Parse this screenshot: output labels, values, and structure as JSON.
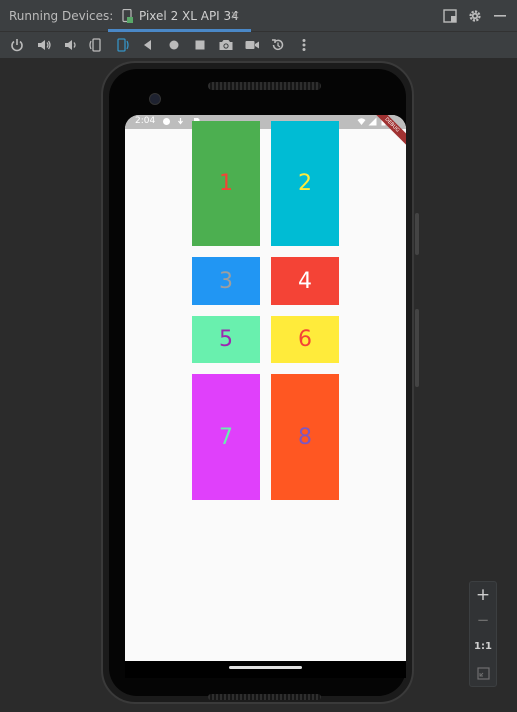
{
  "tabbar": {
    "title": "Running Devices:",
    "tab_label": "Pixel 2 XL API 34",
    "tab_close": "×",
    "right_icons": [
      "layout-icon",
      "gear-icon",
      "minimize-icon"
    ]
  },
  "toolbar": {
    "icons": [
      "power-icon",
      "volume-up-icon",
      "volume-down-icon",
      "rotate-left-icon",
      "rotate-right-icon",
      "back-icon",
      "home-icon",
      "overview-icon",
      "screenshot-icon",
      "screen-record-icon",
      "snapshot-icon",
      "more-icon"
    ]
  },
  "device": {
    "status_time": "2:04",
    "debug_banner": "DEBUG",
    "boxes": [
      {
        "label": "1",
        "bg": "#4caf50",
        "fg": "#f44336"
      },
      {
        "label": "2",
        "bg": "#00bcd4",
        "fg": "#ffeb3b"
      },
      {
        "label": "3",
        "bg": "#2196f3",
        "fg": "#9e9e9e"
      },
      {
        "label": "4",
        "bg": "#f44336",
        "fg": "#ffffff"
      },
      {
        "label": "5",
        "bg": "#69f0ae",
        "fg": "#9c27b0"
      },
      {
        "label": "6",
        "bg": "#ffeb3b",
        "fg": "#f44336"
      },
      {
        "label": "7",
        "bg": "#e040fb",
        "fg": "#69f0ae"
      },
      {
        "label": "8",
        "bg": "#ff5722",
        "fg": "#7e57c2"
      }
    ]
  },
  "zoom": {
    "zoom_in": "+",
    "zoom_out": "−",
    "actual_size": "1:1"
  }
}
